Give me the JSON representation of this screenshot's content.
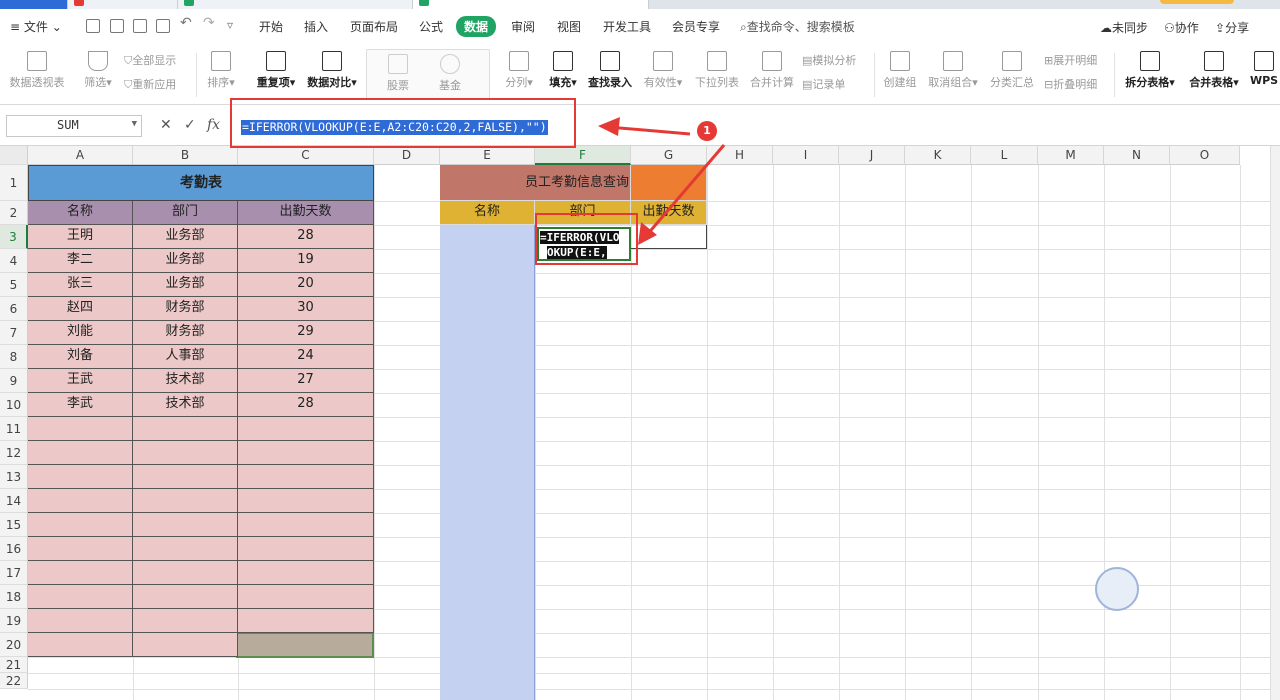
{
  "menu": {
    "file": "文件",
    "tabs": [
      "开始",
      "插入",
      "页面布局",
      "公式",
      "数据",
      "审阅",
      "视图",
      "开发工具",
      "会员专享"
    ],
    "active_tab": "数据",
    "search": "查找命令、搜索模板",
    "right": [
      "未同步",
      "协作",
      "分享"
    ]
  },
  "ribbon": {
    "pivot": "数据透视表",
    "filter": "筛选",
    "show_all": "全部显示",
    "reapply": "重新应用",
    "sort": "排序",
    "duplicates": "重复项",
    "compare": "数据对比",
    "stock": "股票",
    "fund": "基金",
    "split_col": "分列",
    "fill": "填充",
    "lookup": "查找录入",
    "validity": "有效性",
    "dropdown": "下拉列表",
    "consolidate": "合并计算",
    "simulate": "模拟分析",
    "record": "记录单",
    "group": "创建组",
    "ungroup": "取消组合",
    "subtotal": "分类汇总",
    "expand": "展开明细",
    "collapse": "折叠明细",
    "split_table": "拆分表格",
    "merge_table": "合并表格",
    "wps": "WPS"
  },
  "formula_bar": {
    "name_box": "SUM",
    "cancel": "✕",
    "confirm": "✓",
    "fx": "fx",
    "formula": "=IFERROR(VLOOKUP(E:E,A2:C20:C20,2,FALSE),\"\")"
  },
  "columns": [
    "A",
    "B",
    "C",
    "D",
    "E",
    "F",
    "G",
    "H",
    "I",
    "J",
    "K",
    "L",
    "M",
    "N",
    "O"
  ],
  "rows": [
    "1",
    "2",
    "3",
    "4",
    "5",
    "6",
    "7",
    "8",
    "9",
    "10",
    "11",
    "12",
    "13",
    "14",
    "15",
    "16",
    "17",
    "18",
    "19",
    "20",
    "21",
    "22"
  ],
  "attendance": {
    "title": "考勤表",
    "headers": [
      "名称",
      "部门",
      "出勤天数"
    ],
    "records": [
      [
        "王明",
        "业务部",
        "28"
      ],
      [
        "李二",
        "业务部",
        "19"
      ],
      [
        "张三",
        "业务部",
        "20"
      ],
      [
        "赵四",
        "财务部",
        "30"
      ],
      [
        "刘能",
        "财务部",
        "29"
      ],
      [
        "刘备",
        "人事部",
        "24"
      ],
      [
        "王武",
        "技术部",
        "27"
      ],
      [
        "李武",
        "技术部",
        "28"
      ]
    ]
  },
  "query": {
    "title": "员工考勤信息查询",
    "headers": [
      "名称",
      "部门",
      "出勤天数"
    ],
    "edit_line1": "=IFERROR(VLO",
    "edit_line2": "OKUP(E:E,"
  },
  "annotation": {
    "badge": "1"
  },
  "colors": {
    "accent_green": "#1fa463",
    "highlight_red": "#e53935",
    "title_blue": "#5b9bd5"
  }
}
